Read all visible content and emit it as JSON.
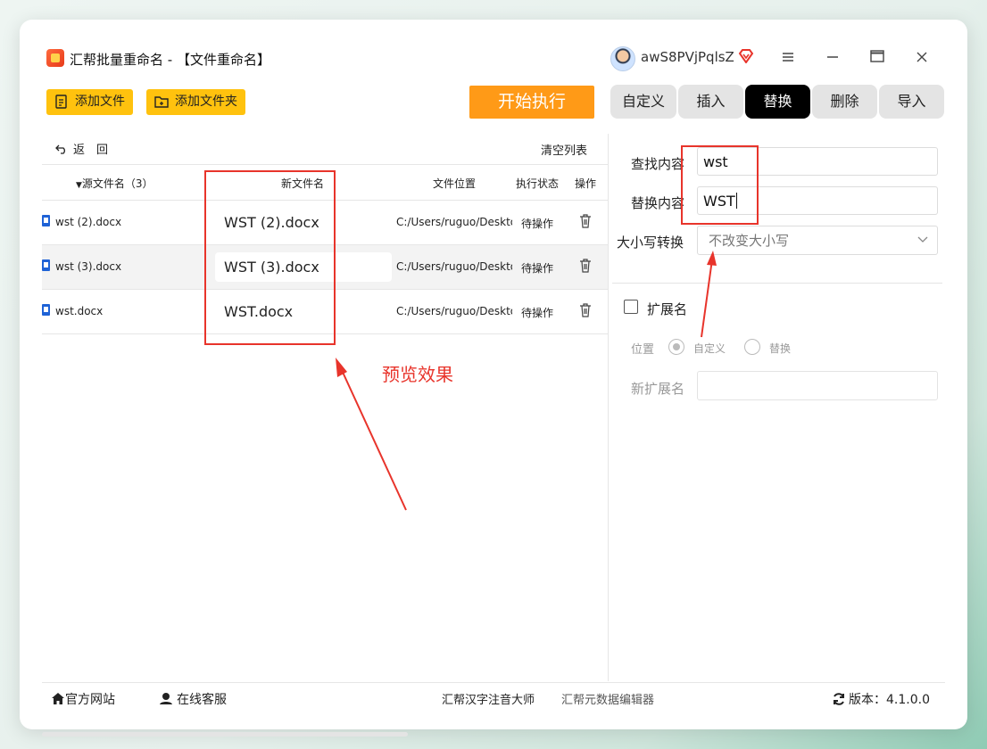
{
  "app": {
    "title": "汇帮批量重命名 - 【文件重命名】",
    "username": "awS8PVjPqlsZ",
    "window_controls": [
      "menu-icon",
      "minimize-icon",
      "maximize-icon",
      "close-icon"
    ]
  },
  "toolbar": {
    "add_file": "添加文件",
    "add_folder": "添加文件夹",
    "start": "开始执行"
  },
  "tabs": [
    {
      "label": "自定义",
      "active": false
    },
    {
      "label": "插入",
      "active": false
    },
    {
      "label": "替换",
      "active": true
    },
    {
      "label": "删除",
      "active": false
    },
    {
      "label": "导入",
      "active": false
    }
  ],
  "list": {
    "back": "返　回",
    "clear": "清空列表",
    "headers": {
      "source": "源文件名（3）",
      "new_name": "新文件名",
      "location": "文件位置",
      "status": "执行状态",
      "action": "操作"
    },
    "rows": [
      {
        "source": "wst (2).docx",
        "new_name": "WST (2).docx",
        "location": "C:/Users/ruguo/Deskto",
        "status": "待操作"
      },
      {
        "source": "wst (3).docx",
        "new_name": "WST (3).docx",
        "location": "C:/Users/ruguo/Deskto",
        "status": "待操作"
      },
      {
        "source": "wst.docx",
        "new_name": "WST.docx",
        "location": "C:/Users/ruguo/Deskto",
        "status": "待操作"
      }
    ]
  },
  "replace_panel": {
    "find_label": "查找内容",
    "find_value": "wst",
    "replace_label": "替换内容",
    "replace_value": "WST",
    "case_label": "大小写转换",
    "case_value": "不改变大小写",
    "ext_label": "扩展名",
    "position_label": "位置",
    "position_options": [
      "自定义",
      "替换"
    ],
    "position_selected": "自定义",
    "new_ext_label": "新扩展名",
    "new_ext_value": ""
  },
  "statusbar": {
    "website": "官方网站",
    "support": "在线客服",
    "product1": "汇帮汉字注音大师",
    "product2": "汇帮元数据编辑器",
    "version": "版本：4.1.0.0"
  },
  "annotation": {
    "preview_label": "预览效果",
    "color": "#e8342b"
  },
  "colors": {
    "yellow_button": "#ffc20e",
    "start_button": "#ff9a17",
    "active_tab": "#000000",
    "annotation_red": "#e8342b"
  }
}
